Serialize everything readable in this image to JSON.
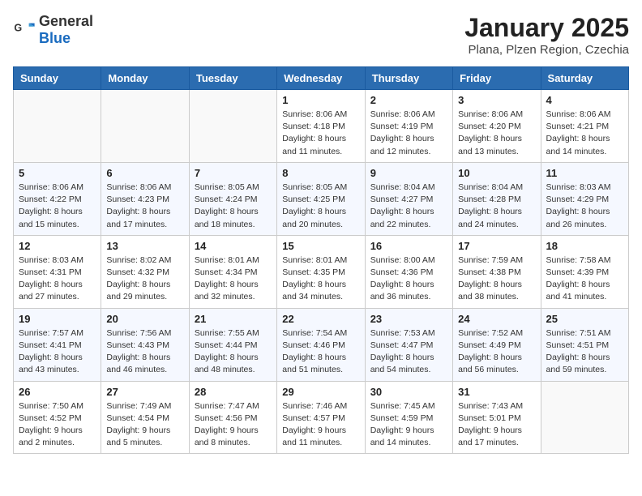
{
  "header": {
    "logo_general": "General",
    "logo_blue": "Blue",
    "month": "January 2025",
    "location": "Plana, Plzen Region, Czechia"
  },
  "weekdays": [
    "Sunday",
    "Monday",
    "Tuesday",
    "Wednesday",
    "Thursday",
    "Friday",
    "Saturday"
  ],
  "weeks": [
    [
      {
        "day": "",
        "detail": ""
      },
      {
        "day": "",
        "detail": ""
      },
      {
        "day": "",
        "detail": ""
      },
      {
        "day": "1",
        "detail": "Sunrise: 8:06 AM\nSunset: 4:18 PM\nDaylight: 8 hours\nand 11 minutes."
      },
      {
        "day": "2",
        "detail": "Sunrise: 8:06 AM\nSunset: 4:19 PM\nDaylight: 8 hours\nand 12 minutes."
      },
      {
        "day": "3",
        "detail": "Sunrise: 8:06 AM\nSunset: 4:20 PM\nDaylight: 8 hours\nand 13 minutes."
      },
      {
        "day": "4",
        "detail": "Sunrise: 8:06 AM\nSunset: 4:21 PM\nDaylight: 8 hours\nand 14 minutes."
      }
    ],
    [
      {
        "day": "5",
        "detail": "Sunrise: 8:06 AM\nSunset: 4:22 PM\nDaylight: 8 hours\nand 15 minutes."
      },
      {
        "day": "6",
        "detail": "Sunrise: 8:06 AM\nSunset: 4:23 PM\nDaylight: 8 hours\nand 17 minutes."
      },
      {
        "day": "7",
        "detail": "Sunrise: 8:05 AM\nSunset: 4:24 PM\nDaylight: 8 hours\nand 18 minutes."
      },
      {
        "day": "8",
        "detail": "Sunrise: 8:05 AM\nSunset: 4:25 PM\nDaylight: 8 hours\nand 20 minutes."
      },
      {
        "day": "9",
        "detail": "Sunrise: 8:04 AM\nSunset: 4:27 PM\nDaylight: 8 hours\nand 22 minutes."
      },
      {
        "day": "10",
        "detail": "Sunrise: 8:04 AM\nSunset: 4:28 PM\nDaylight: 8 hours\nand 24 minutes."
      },
      {
        "day": "11",
        "detail": "Sunrise: 8:03 AM\nSunset: 4:29 PM\nDaylight: 8 hours\nand 26 minutes."
      }
    ],
    [
      {
        "day": "12",
        "detail": "Sunrise: 8:03 AM\nSunset: 4:31 PM\nDaylight: 8 hours\nand 27 minutes."
      },
      {
        "day": "13",
        "detail": "Sunrise: 8:02 AM\nSunset: 4:32 PM\nDaylight: 8 hours\nand 29 minutes."
      },
      {
        "day": "14",
        "detail": "Sunrise: 8:01 AM\nSunset: 4:34 PM\nDaylight: 8 hours\nand 32 minutes."
      },
      {
        "day": "15",
        "detail": "Sunrise: 8:01 AM\nSunset: 4:35 PM\nDaylight: 8 hours\nand 34 minutes."
      },
      {
        "day": "16",
        "detail": "Sunrise: 8:00 AM\nSunset: 4:36 PM\nDaylight: 8 hours\nand 36 minutes."
      },
      {
        "day": "17",
        "detail": "Sunrise: 7:59 AM\nSunset: 4:38 PM\nDaylight: 8 hours\nand 38 minutes."
      },
      {
        "day": "18",
        "detail": "Sunrise: 7:58 AM\nSunset: 4:39 PM\nDaylight: 8 hours\nand 41 minutes."
      }
    ],
    [
      {
        "day": "19",
        "detail": "Sunrise: 7:57 AM\nSunset: 4:41 PM\nDaylight: 8 hours\nand 43 minutes."
      },
      {
        "day": "20",
        "detail": "Sunrise: 7:56 AM\nSunset: 4:43 PM\nDaylight: 8 hours\nand 46 minutes."
      },
      {
        "day": "21",
        "detail": "Sunrise: 7:55 AM\nSunset: 4:44 PM\nDaylight: 8 hours\nand 48 minutes."
      },
      {
        "day": "22",
        "detail": "Sunrise: 7:54 AM\nSunset: 4:46 PM\nDaylight: 8 hours\nand 51 minutes."
      },
      {
        "day": "23",
        "detail": "Sunrise: 7:53 AM\nSunset: 4:47 PM\nDaylight: 8 hours\nand 54 minutes."
      },
      {
        "day": "24",
        "detail": "Sunrise: 7:52 AM\nSunset: 4:49 PM\nDaylight: 8 hours\nand 56 minutes."
      },
      {
        "day": "25",
        "detail": "Sunrise: 7:51 AM\nSunset: 4:51 PM\nDaylight: 8 hours\nand 59 minutes."
      }
    ],
    [
      {
        "day": "26",
        "detail": "Sunrise: 7:50 AM\nSunset: 4:52 PM\nDaylight: 9 hours\nand 2 minutes."
      },
      {
        "day": "27",
        "detail": "Sunrise: 7:49 AM\nSunset: 4:54 PM\nDaylight: 9 hours\nand 5 minutes."
      },
      {
        "day": "28",
        "detail": "Sunrise: 7:47 AM\nSunset: 4:56 PM\nDaylight: 9 hours\nand 8 minutes."
      },
      {
        "day": "29",
        "detail": "Sunrise: 7:46 AM\nSunset: 4:57 PM\nDaylight: 9 hours\nand 11 minutes."
      },
      {
        "day": "30",
        "detail": "Sunrise: 7:45 AM\nSunset: 4:59 PM\nDaylight: 9 hours\nand 14 minutes."
      },
      {
        "day": "31",
        "detail": "Sunrise: 7:43 AM\nSunset: 5:01 PM\nDaylight: 9 hours\nand 17 minutes."
      },
      {
        "day": "",
        "detail": ""
      }
    ]
  ]
}
